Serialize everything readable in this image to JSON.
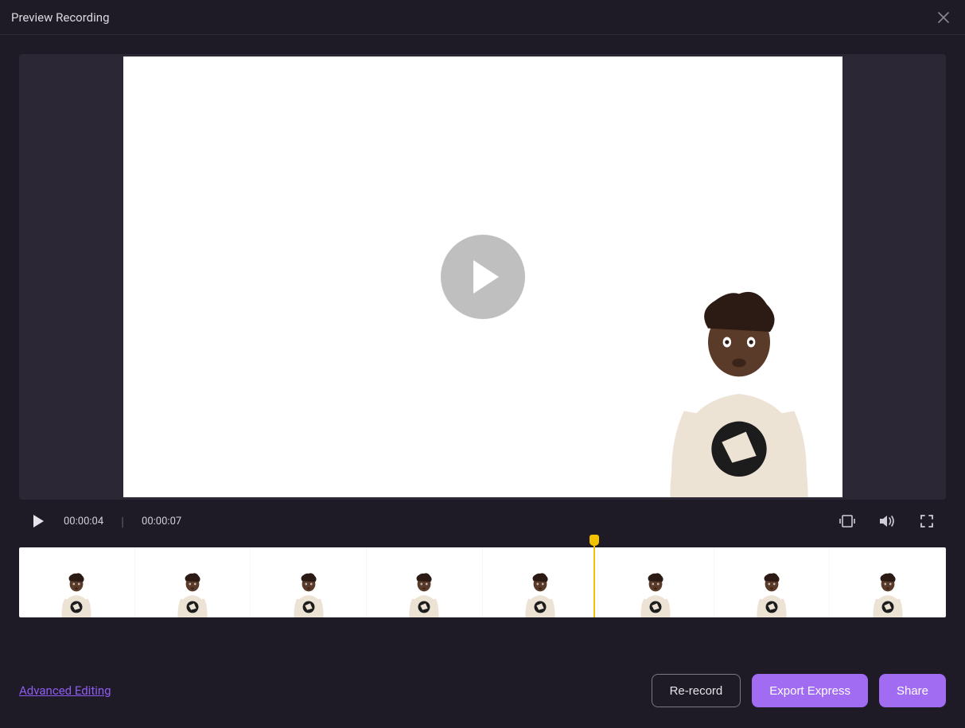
{
  "header": {
    "title": "Preview Recording"
  },
  "player": {
    "current_time": "00:00:04",
    "total_time": "00:00:07"
  },
  "timeline": {
    "playhead_percent": 62,
    "thumb_count": 8
  },
  "footer": {
    "advanced_link": "Advanced Editing",
    "re_record": "Re-record",
    "export_express": "Export Express",
    "share": "Share"
  },
  "colors": {
    "accent": "#a16cf2",
    "link": "#8f5cf1",
    "playhead": "#f2c200"
  }
}
